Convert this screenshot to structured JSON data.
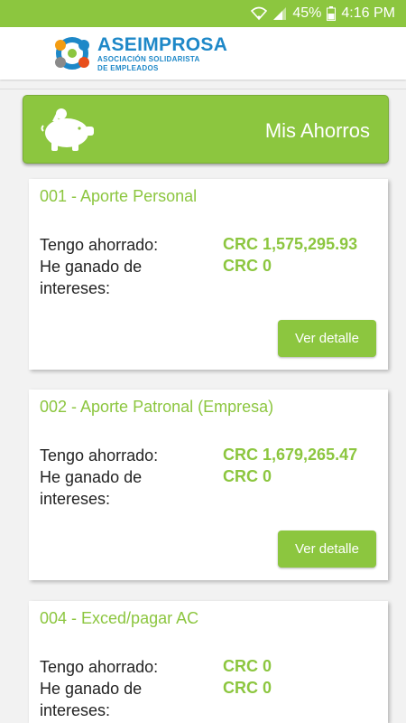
{
  "status_bar": {
    "battery": "45%",
    "time": "4:16 PM"
  },
  "header": {
    "logo_name": "ASEIMPROSA",
    "logo_sub_1": "ASOCIACIÓN SOLIDARISTA",
    "logo_sub_2": "DE EMPLEADOS"
  },
  "banner": {
    "title": "Mis Ahorros",
    "icon": "piggy-bank-icon"
  },
  "accounts": [
    {
      "title": "001 - Aporte Personal",
      "saved_label": "Tengo ahorrado:",
      "saved_value": "CRC 1,575,295.93",
      "interest_label_1": "He ganado de",
      "interest_label_2": "intereses:",
      "interest_value": "CRC 0",
      "button": "Ver detalle"
    },
    {
      "title": "002 - Aporte Patronal (Empresa)",
      "saved_label": "Tengo ahorrado:",
      "saved_value": "CRC 1,679,265.47",
      "interest_label_1": "He ganado de",
      "interest_label_2": "intereses:",
      "interest_value": "CRC 0",
      "button": "Ver detalle"
    },
    {
      "title": "004 - Exced/pagar AC",
      "saved_label": "Tengo ahorrado:",
      "saved_value": "CRC 0",
      "interest_label_1": "He ganado de",
      "interest_label_2": "intereses:",
      "interest_value": "CRC 0"
    }
  ],
  "colors": {
    "accent": "#8cc63f",
    "brand_blue": "#1e88c8"
  }
}
